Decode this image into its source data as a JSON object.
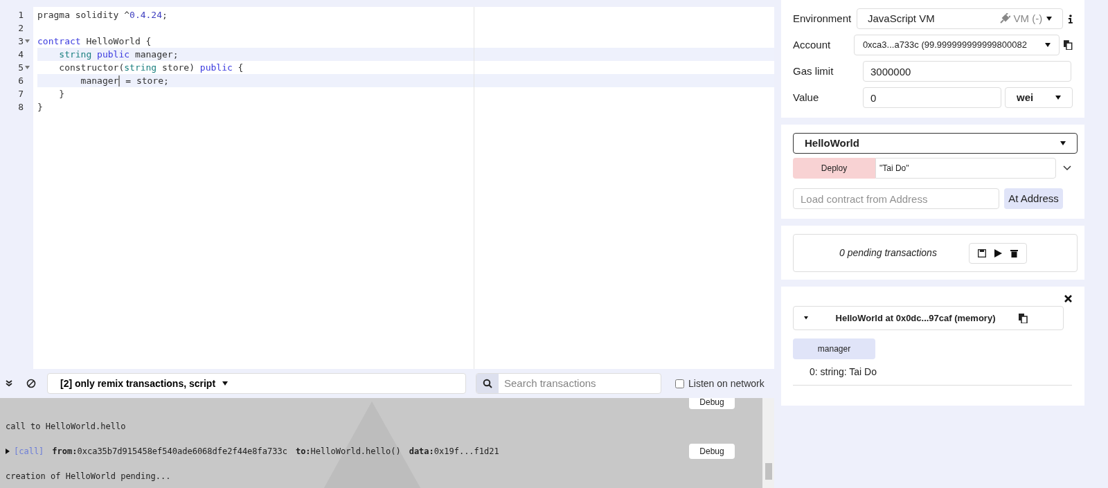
{
  "editor": {
    "lines": [
      {
        "number": "1",
        "fold": false,
        "highlighted": false,
        "tokens": [
          {
            "kind": "plain",
            "text": "pragma solidity ^"
          },
          {
            "kind": "number",
            "text": "0.4.24"
          },
          {
            "kind": "plain",
            "text": ";"
          }
        ]
      },
      {
        "number": "2",
        "fold": false,
        "highlighted": false
      },
      {
        "number": "3",
        "fold": true,
        "highlighted": false,
        "tokens": [
          {
            "kind": "keyword",
            "text": "contract"
          },
          {
            "kind": "plain",
            "text": " HelloWorld {"
          }
        ]
      },
      {
        "number": "4",
        "fold": false,
        "highlighted": true,
        "tokens": [
          {
            "kind": "type",
            "text": "    string "
          },
          {
            "kind": "keyword",
            "text": "public"
          },
          {
            "kind": "plain",
            "text": " manager;"
          }
        ]
      },
      {
        "number": "5",
        "fold": true,
        "highlighted": false,
        "tokens": [
          {
            "kind": "plain",
            "text": "    constructor("
          },
          {
            "kind": "type",
            "text": "string"
          },
          {
            "kind": "plain",
            "text": " store) "
          },
          {
            "kind": "keyword",
            "text": "public"
          },
          {
            "kind": "plain",
            "text": " {"
          }
        ]
      },
      {
        "number": "6",
        "fold": false,
        "highlighted": true,
        "tokens": [
          {
            "kind": "plain",
            "text": "        manager"
          },
          {
            "kind": "cursor"
          },
          {
            "kind": "plain",
            "text": " = store;"
          }
        ]
      },
      {
        "number": "7",
        "fold": false,
        "highlighted": false,
        "tokens": [
          {
            "kind": "plain",
            "text": "    }"
          }
        ]
      },
      {
        "number": "8",
        "fold": false,
        "highlighted": false,
        "tokens": [
          {
            "kind": "plain",
            "text": "}"
          }
        ]
      }
    ]
  },
  "console": {
    "filter": "[2] only remix transactions, script",
    "search_placeholder": "Search transactions",
    "listen_label": "Listen on network",
    "listen_checked": false,
    "entries": [
      {
        "kind": "debug",
        "debug": "Debug"
      },
      {
        "kind": "message",
        "text": "call to HelloWorld.hello"
      },
      {
        "kind": "tx",
        "tag": "[call]",
        "parts": [
          {
            "key": "from:",
            "value": "0xca35b7d915458ef540ade6068dfe2f44e8fa733c"
          },
          {
            "key": "to:",
            "value": "HelloWorld.hello()"
          },
          {
            "key": "data:",
            "value": "0x19f...f1d21"
          }
        ],
        "debug": "Debug"
      },
      {
        "kind": "message",
        "text": "creation of HelloWorld pending..."
      }
    ]
  },
  "settings": {
    "environment": {
      "label": "Environment",
      "value": "JavaScript VM",
      "badge": "VM (-)"
    },
    "account": {
      "label": "Account",
      "value": "0xca3...a733c (99.999999999999800082"
    },
    "gas_limit": {
      "label": "Gas limit",
      "value": "3000000"
    },
    "value": {
      "label": "Value",
      "value": "0",
      "unit": "wei"
    }
  },
  "deploy": {
    "contract": "HelloWorld",
    "button": "Deploy",
    "args": "\"Tai Do\"",
    "address_placeholder": "Load contract from Address",
    "at_address": "At Address"
  },
  "pending": {
    "text": "0 pending transactions"
  },
  "instance": {
    "title": "HelloWorld at 0x0dc...97caf (memory)",
    "expanded": true,
    "function": "manager",
    "result": "0: string: Tai Do"
  }
}
